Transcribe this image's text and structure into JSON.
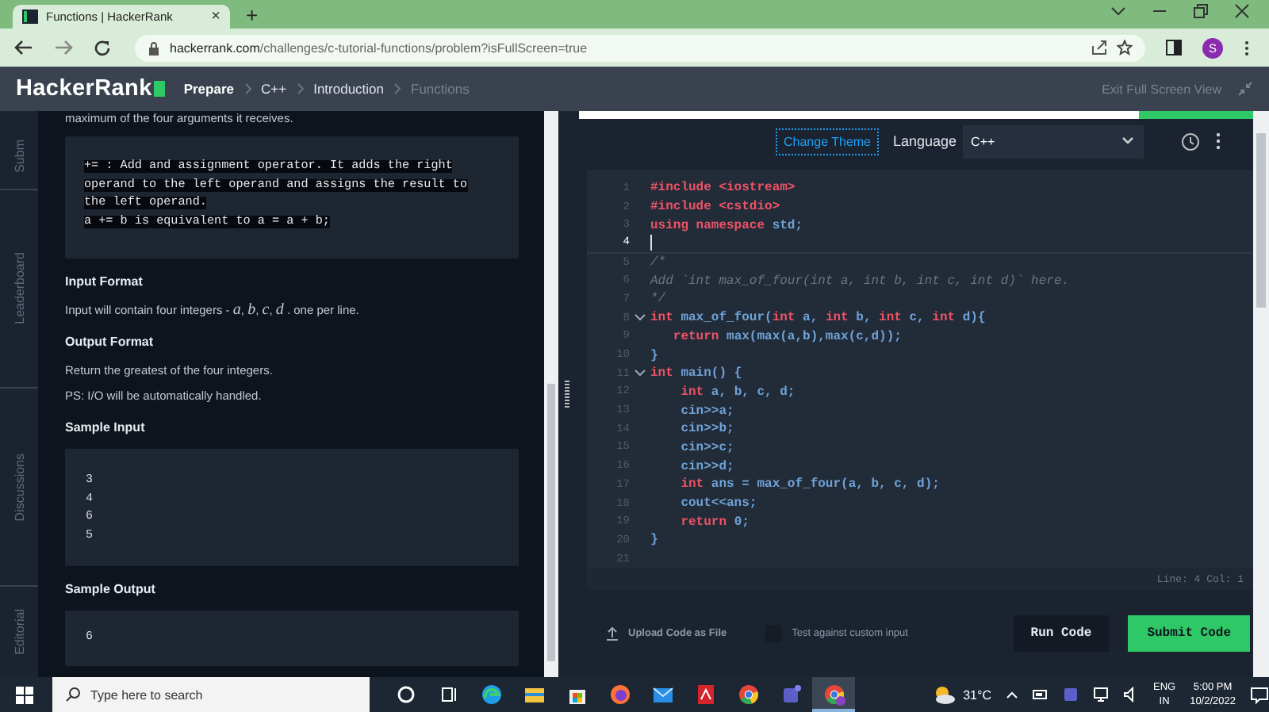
{
  "browser": {
    "tab": {
      "title": "Functions | HackerRank",
      "close": "×"
    },
    "new_tab": "+",
    "url": {
      "domain": "hackerrank.com",
      "path": "/challenges/c-tutorial-functions/problem?isFullScreen=true"
    },
    "profile": "S"
  },
  "header": {
    "logo": "HackerRank",
    "breadcrumb": [
      {
        "label": "Prepare",
        "kind": "root"
      },
      {
        "label": "C++",
        "kind": "link"
      },
      {
        "label": "Introduction",
        "kind": "link"
      },
      {
        "label": "Functions",
        "kind": "current"
      }
    ],
    "exit": "Exit Full Screen View"
  },
  "side_tabs": [
    {
      "label": "Subm"
    },
    {
      "label": "Leaderboard"
    },
    {
      "label": "Discussions"
    },
    {
      "label": "Editorial"
    }
  ],
  "problem": {
    "blocks": [
      {
        "kind": "text",
        "text": "maximum of the four arguments it receives."
      },
      {
        "kind": "code",
        "text": "+= : Add and assignment operator. It adds the right\noperand to the left operand and assigns the result to\nthe left operand.\na += b is equivalent to a = a + b;"
      },
      {
        "kind": "heading",
        "text": "Input Format"
      },
      {
        "kind": "text",
        "text": "Input will contain four integers - *a*, *b*, *c*, *d* . one per line."
      },
      {
        "kind": "heading",
        "text": "Output Format"
      },
      {
        "kind": "text",
        "text": "Return the greatest of the four integers."
      },
      {
        "kind": "text",
        "text": "PS: I/O will be automatically handled."
      },
      {
        "kind": "heading",
        "text": "Sample Input"
      },
      {
        "kind": "sample",
        "text": "3\n4\n6\n5"
      },
      {
        "kind": "heading",
        "text": "Sample Output"
      },
      {
        "kind": "sample",
        "text": "6"
      }
    ]
  },
  "editor": {
    "progress": {
      "level": 0.83
    },
    "change_theme": "Change Theme",
    "language_label": "Language",
    "language": "C++",
    "lines": [
      {
        "number": "1",
        "fold": false,
        "current": false,
        "tokens": [
          {
            "kind": "kw",
            "text": "#include <iostream>"
          }
        ]
      },
      {
        "number": "2",
        "fold": false,
        "current": false,
        "tokens": [
          {
            "kind": "kw",
            "text": "#include <cstdio>"
          }
        ]
      },
      {
        "number": "3",
        "fold": false,
        "current": false,
        "tokens": [
          {
            "kind": "kw",
            "text": "using namespace"
          },
          {
            "kind": "id",
            "text": " std;"
          }
        ]
      },
      {
        "number": "4",
        "fold": false,
        "current": true
      },
      {
        "number": "5",
        "fold": false,
        "current": false,
        "tokens": [
          {
            "kind": "cm",
            "text": "/*"
          }
        ]
      },
      {
        "number": "6",
        "fold": false,
        "current": false,
        "tokens": [
          {
            "kind": "cm",
            "text": "Add `int max_of_four(int a, int b, int c, int d)` here."
          }
        ]
      },
      {
        "number": "7",
        "fold": false,
        "current": false,
        "tokens": [
          {
            "kind": "cm",
            "text": "*/"
          }
        ]
      },
      {
        "number": "8",
        "fold": true,
        "current": false,
        "tokens": [
          {
            "kind": "kw",
            "text": "int"
          },
          {
            "kind": "id",
            "text": " max_of_four("
          },
          {
            "kind": "kw",
            "text": "int"
          },
          {
            "kind": "id",
            "text": " a, "
          },
          {
            "kind": "kw",
            "text": "int"
          },
          {
            "kind": "id",
            "text": " b, "
          },
          {
            "kind": "kw",
            "text": "int"
          },
          {
            "kind": "id",
            "text": " c, "
          },
          {
            "kind": "kw",
            "text": "int"
          },
          {
            "kind": "id",
            "text": " d){"
          }
        ]
      },
      {
        "number": "9",
        "fold": false,
        "current": false,
        "tokens": [
          {
            "kind": "kw",
            "text": "   return"
          },
          {
            "kind": "id",
            "text": " max(max(a,b),max(c,d));"
          }
        ]
      },
      {
        "number": "10",
        "fold": false,
        "current": false,
        "tokens": [
          {
            "kind": "id",
            "text": "}"
          }
        ]
      },
      {
        "number": "11",
        "fold": true,
        "current": false,
        "tokens": [
          {
            "kind": "kw",
            "text": "int"
          },
          {
            "kind": "id",
            "text": " main() {"
          }
        ]
      },
      {
        "number": "12",
        "fold": false,
        "current": false,
        "tokens": [
          {
            "kind": "kw",
            "text": "    int"
          },
          {
            "kind": "id",
            "text": " a, b, c, d;"
          }
        ]
      },
      {
        "number": "13",
        "fold": false,
        "current": false,
        "tokens": [
          {
            "kind": "id",
            "text": "    cin>>a;"
          }
        ]
      },
      {
        "number": "14",
        "fold": false,
        "current": false,
        "tokens": [
          {
            "kind": "id",
            "text": "    cin>>b;"
          }
        ]
      },
      {
        "number": "15",
        "fold": false,
        "current": false,
        "tokens": [
          {
            "kind": "id",
            "text": "    cin>>c;"
          }
        ]
      },
      {
        "number": "16",
        "fold": false,
        "current": false,
        "tokens": [
          {
            "kind": "id",
            "text": "    cin>>d;"
          }
        ]
      },
      {
        "number": "17",
        "fold": false,
        "current": false,
        "tokens": [
          {
            "kind": "kw",
            "text": "    int"
          },
          {
            "kind": "id",
            "text": " ans = max_of_four(a, b, c, d);"
          }
        ]
      },
      {
        "number": "18",
        "fold": false,
        "current": false,
        "tokens": [
          {
            "kind": "id",
            "text": "    cout<<ans;"
          }
        ]
      },
      {
        "number": "19",
        "fold": false,
        "current": false,
        "tokens": [
          {
            "kind": "kw",
            "text": "    return"
          },
          {
            "kind": "id",
            "text": " 0;"
          }
        ]
      },
      {
        "number": "20",
        "fold": false,
        "current": false,
        "tokens": [
          {
            "kind": "id",
            "text": "}"
          }
        ]
      },
      {
        "number": "21",
        "fold": false,
        "current": false
      }
    ],
    "status": "Line: 4 Col: 1",
    "upload": "Upload Code as File",
    "custom_input": {
      "label": "Test against custom input",
      "checked": false
    },
    "run": "Run Code",
    "submit": "Submit Code"
  },
  "taskbar": {
    "search": {
      "placeholder": "Type here to search"
    },
    "apps": [
      {
        "selected": false
      },
      {
        "selected": false
      },
      {
        "selected": false
      },
      {
        "selected": false
      },
      {
        "selected": false
      },
      {
        "selected": false
      },
      {
        "selected": false
      },
      {
        "selected": false
      },
      {
        "selected": false
      },
      {
        "selected": false
      },
      {
        "selected": true
      }
    ],
    "temperature": "31°C",
    "language": "ENG",
    "region": "IN",
    "time": "5:00 PM",
    "date": "10/2/2022"
  }
}
